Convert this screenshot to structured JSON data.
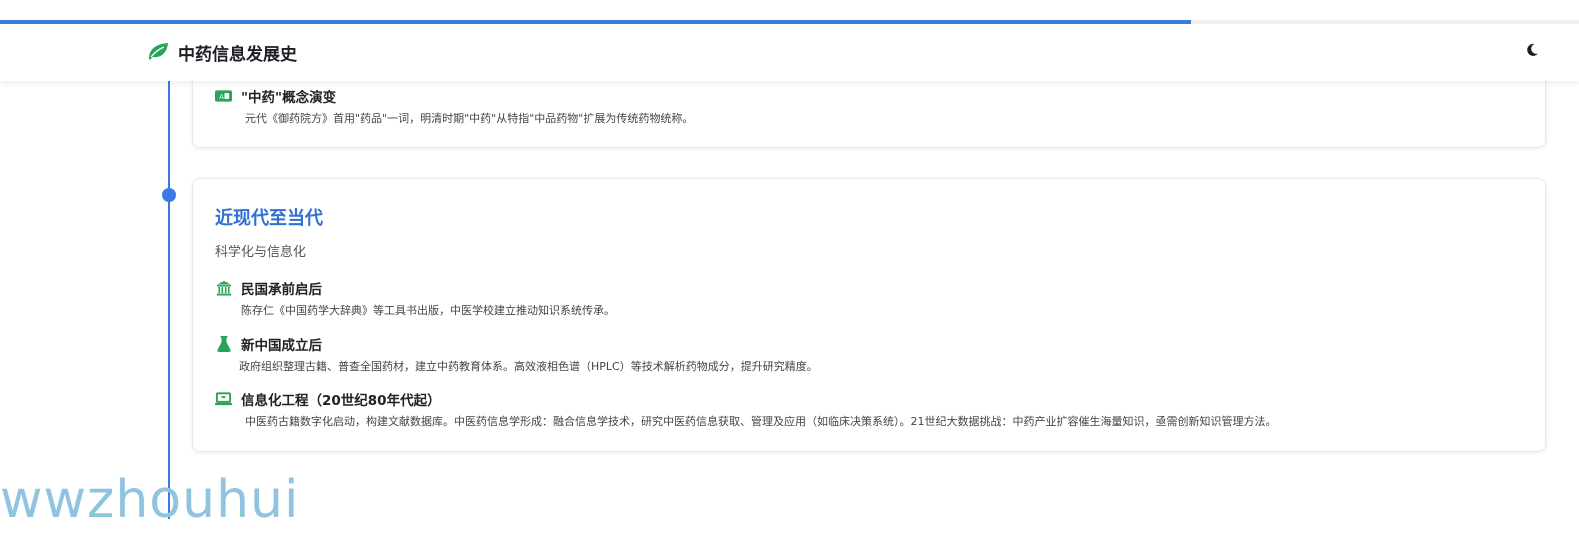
{
  "progress": {
    "fraction": 0.754
  },
  "header": {
    "title": "中药信息发展史",
    "logo_icon": "leaf-icon",
    "theme_toggle_icon": "moon-icon"
  },
  "colors": {
    "accent": "#3b7be0",
    "icon_green": "#27a35a"
  },
  "prev_card": {
    "items": [
      {
        "icon": "translate-icon",
        "title": "\"中药\"概念演变",
        "desc": "元代《御药院方》首用\"药品\"一词，明清时期\"中药\"从特指\"中品药物\"扩展为传统药物统称。"
      }
    ]
  },
  "era": {
    "title": "近现代至当代",
    "subtitle": "科学化与信息化",
    "items": [
      {
        "icon": "landmark-icon",
        "title": "民国承前启后",
        "desc": "陈存仁《中国药学大辞典》等工具书出版，中医学校建立推动知识系统传承。"
      },
      {
        "icon": "flask-icon",
        "title": "新中国成立后",
        "desc": "政府组织整理古籍、普查全国药材，建立中药教育体系。高效液相色谱（HPLC）等技术解析药物成分，提升研究精度。"
      },
      {
        "icon": "laptop-icon",
        "title": "信息化工程（20世纪80年代起）",
        "desc": "中医药古籍数字化启动，构建文献数据库。中医药信息学形成：融合信息学技术，研究中医药信息获取、管理及应用（如临床决策系统）。21世纪大数据挑战：中药产业扩容催生海量知识，亟需创新知识管理方法。"
      }
    ]
  },
  "watermark": {
    "text": "wwzhouhui"
  }
}
